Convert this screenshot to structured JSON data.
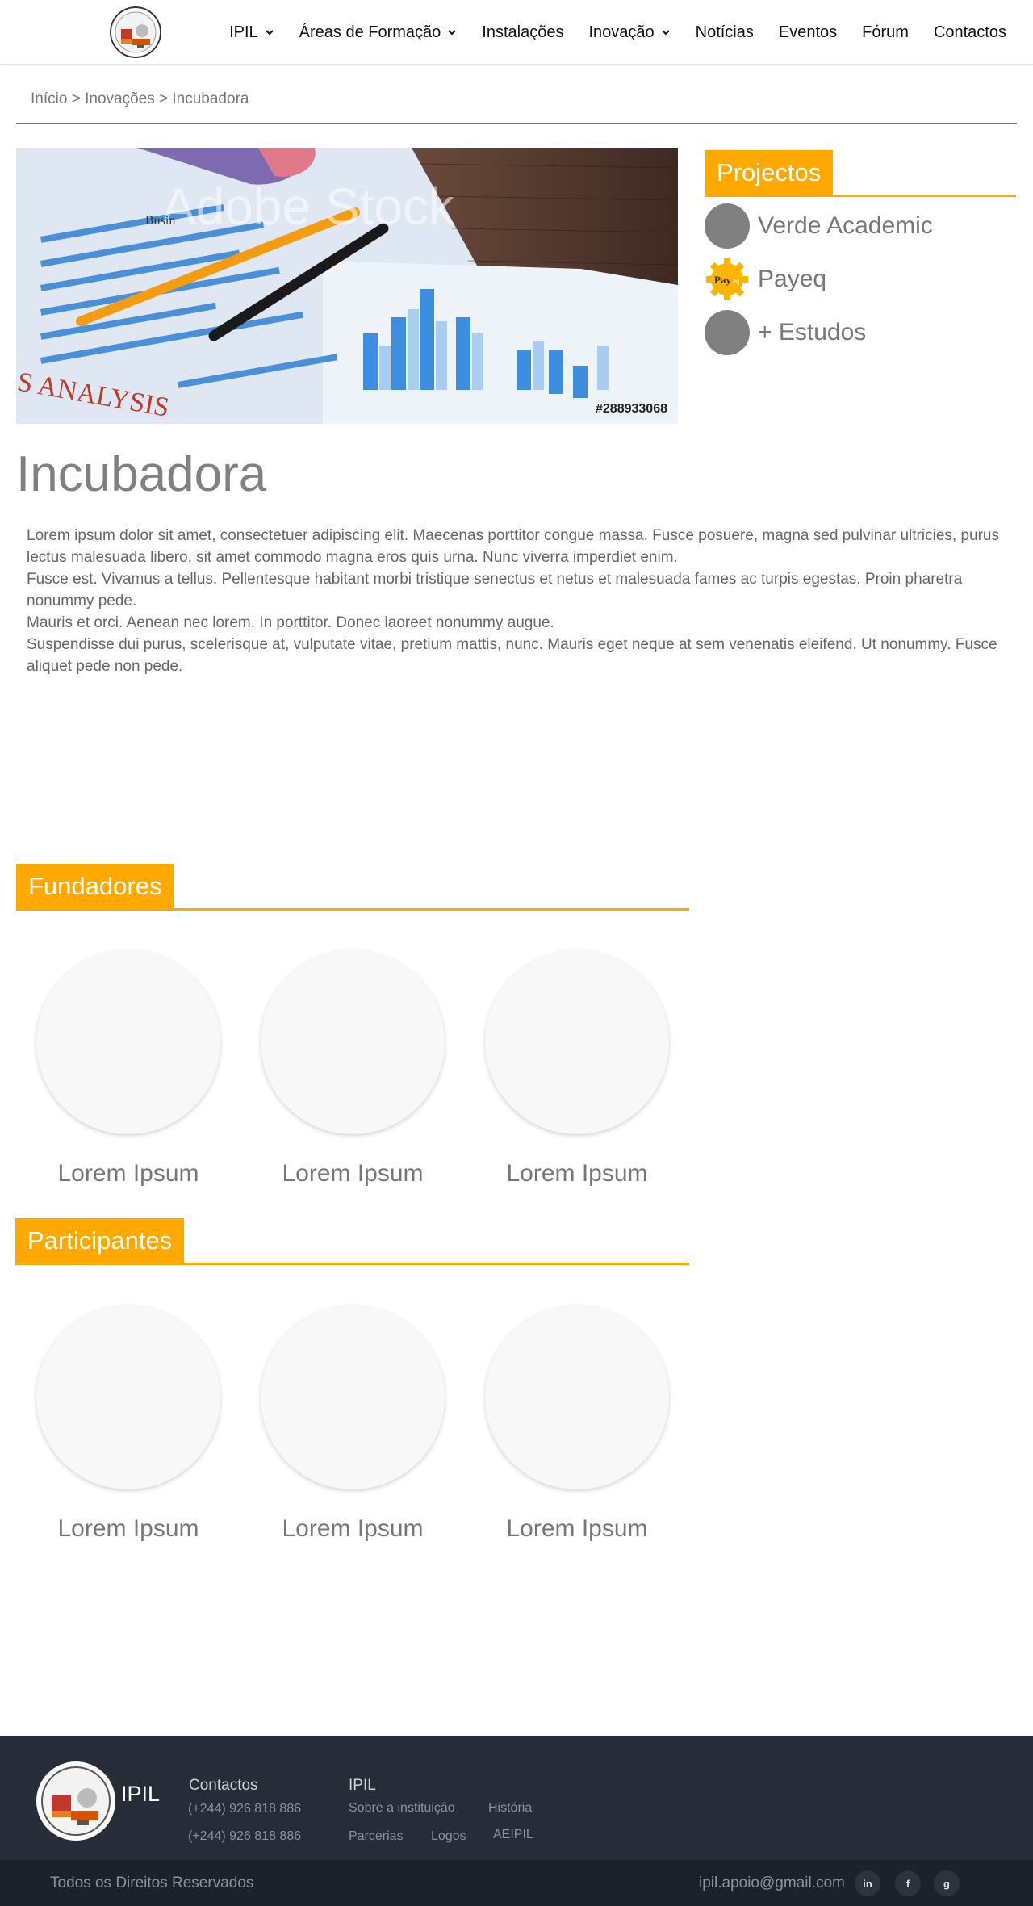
{
  "nav": {
    "items": [
      {
        "label": "IPIL",
        "dropdown": true
      },
      {
        "label": "Áreas de Formação",
        "dropdown": true
      },
      {
        "label": "Instalações",
        "dropdown": false
      },
      {
        "label": "Inovação",
        "dropdown": true
      },
      {
        "label": "Notícias",
        "dropdown": false
      },
      {
        "label": "Eventos",
        "dropdown": false
      },
      {
        "label": "Fórum",
        "dropdown": false
      },
      {
        "label": "Contactos",
        "dropdown": false
      }
    ]
  },
  "breadcrumb": {
    "home": "Início",
    "sep": ">",
    "section": "Inovações",
    "current": "Incubadora"
  },
  "hero": {
    "stock_watermark": "Adobe Stock",
    "stock_id": "#288933068",
    "chart_text": "S ANALYSIS",
    "doc_word": "Busin"
  },
  "projects": {
    "title": "Projectos",
    "items": [
      {
        "label": "Verde Academic",
        "icon": "gray-circle"
      },
      {
        "label": "Payeq",
        "icon": "payeq-gear-logo"
      },
      {
        "label": "+ Estudos",
        "icon": "gray-circle"
      }
    ]
  },
  "page": {
    "title": "Incubadora",
    "paragraphs": [
      "Lorem ipsum dolor sit amet, consectetuer adipiscing elit. Maecenas porttitor congue massa. Fusce posuere, magna sed pulvinar ultricies, purus lectus malesuada libero, sit amet commodo magna eros quis urna. Nunc viverra imperdiet enim.",
      "Fusce est. Vivamus a tellus. Pellentesque habitant morbi tristique senectus et netus et malesuada fames ac turpis egestas. Proin pharetra nonummy pede.",
      "Mauris et orci. Aenean nec lorem. In porttitor. Donec laoreet nonummy augue.",
      "Suspendisse dui purus, scelerisque at, vulputate vitae, pretium mattis, nunc. Mauris eget neque at sem venenatis eleifend. Ut nonummy. Fusce aliquet pede non pede."
    ]
  },
  "founders": {
    "title": "Fundadores",
    "people": [
      "Lorem Ipsum",
      "Lorem Ipsum",
      "Lorem Ipsum"
    ]
  },
  "participants": {
    "title": "Participantes",
    "people": [
      "Lorem Ipsum",
      "Lorem Ipsum",
      "Lorem Ipsum"
    ]
  },
  "footer": {
    "brand": "IPIL",
    "contacts_title": "Contactos",
    "phones": [
      "(+244) 926 818 886",
      "(+244) 926 818 886"
    ],
    "ipil_title": "IPIL",
    "links": [
      "Sobre a instituição",
      "História",
      "Parcerias",
      "Logos",
      "AEIPIL"
    ],
    "rights": "Todos os Direitos Reservados",
    "email": "ipil.apoio@gmail.com",
    "social": [
      {
        "label": "in",
        "icon": "linkedin-icon"
      },
      {
        "label": "f",
        "icon": "facebook-icon"
      },
      {
        "label": "g",
        "icon": "google-icon"
      }
    ]
  },
  "colors": {
    "accent": "#FFA800",
    "footer_bg": "#262D38",
    "footer_bottom_bg": "#1C212B",
    "muted_text": "#777777"
  }
}
